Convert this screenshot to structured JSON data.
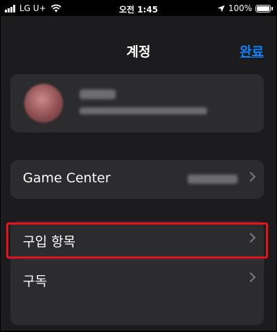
{
  "status_bar": {
    "carrier": "LG U+",
    "time": "오전 1:45",
    "battery_text": "100%",
    "battery_level": 1.0
  },
  "nav": {
    "title": "계정",
    "done_label": "완료"
  },
  "game_center": {
    "label": "Game Center"
  },
  "menu": {
    "purchases_label": "구입 항목",
    "subscriptions_label": "구독"
  },
  "colors": {
    "accent": "#0a84ff",
    "highlight": "#e8121c",
    "background": "#1c1c1e",
    "card": "#2c2c2e"
  },
  "icons": [
    "signal-icon",
    "wifi-icon",
    "location-arrow-icon",
    "battery-icon",
    "chevron-right-icon"
  ]
}
